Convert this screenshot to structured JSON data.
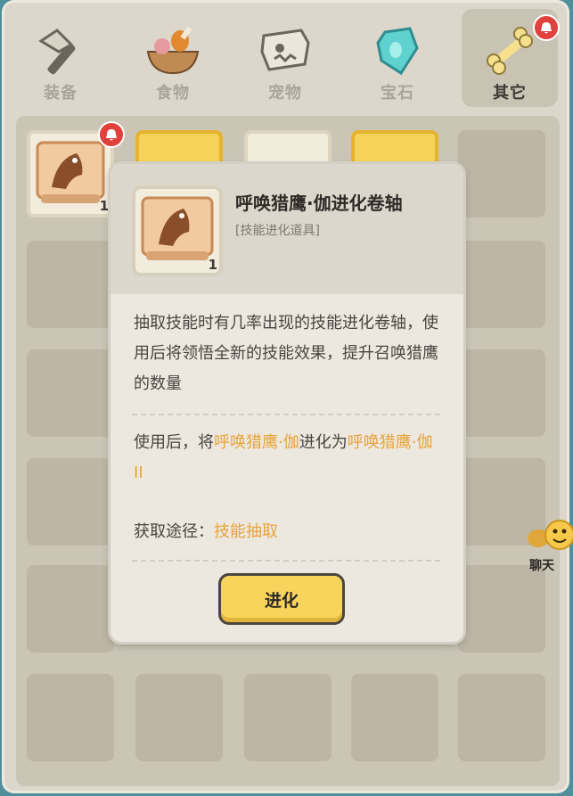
{
  "tabs": [
    {
      "label": "装备",
      "icon": "equipment-hammer-icon",
      "active": false
    },
    {
      "label": "食物",
      "icon": "food-bowl-icon",
      "active": false
    },
    {
      "label": "宠物",
      "icon": "pet-skull-icon",
      "active": false
    },
    {
      "label": "宝石",
      "icon": "gem-icon",
      "active": false
    },
    {
      "label": "其它",
      "icon": "bone-icon",
      "active": true
    }
  ],
  "inventory": {
    "slot1_count": "1"
  },
  "popup": {
    "title": "呼唤猎鹰·伽进化卷轴",
    "category": "[技能进化道具]",
    "icon_count": "1",
    "description": "抽取技能时有几率出现的技能进化卷轴，使用后将领悟全新的技能效果，提升召唤猎鹰的数量",
    "evolve_prefix": "使用后，将",
    "evolve_from": "呼唤猎鹰·伽",
    "evolve_mid": "进化为",
    "evolve_to": "呼唤猎鹰·伽II",
    "source_label": "获取途径：",
    "source_value": "技能抽取",
    "button_label": "进化"
  },
  "chat": {
    "label": "聊天"
  },
  "colors": {
    "accent_gold": "#f7d45b",
    "highlight": "#e8a33a",
    "badge_red": "#e0413c"
  }
}
